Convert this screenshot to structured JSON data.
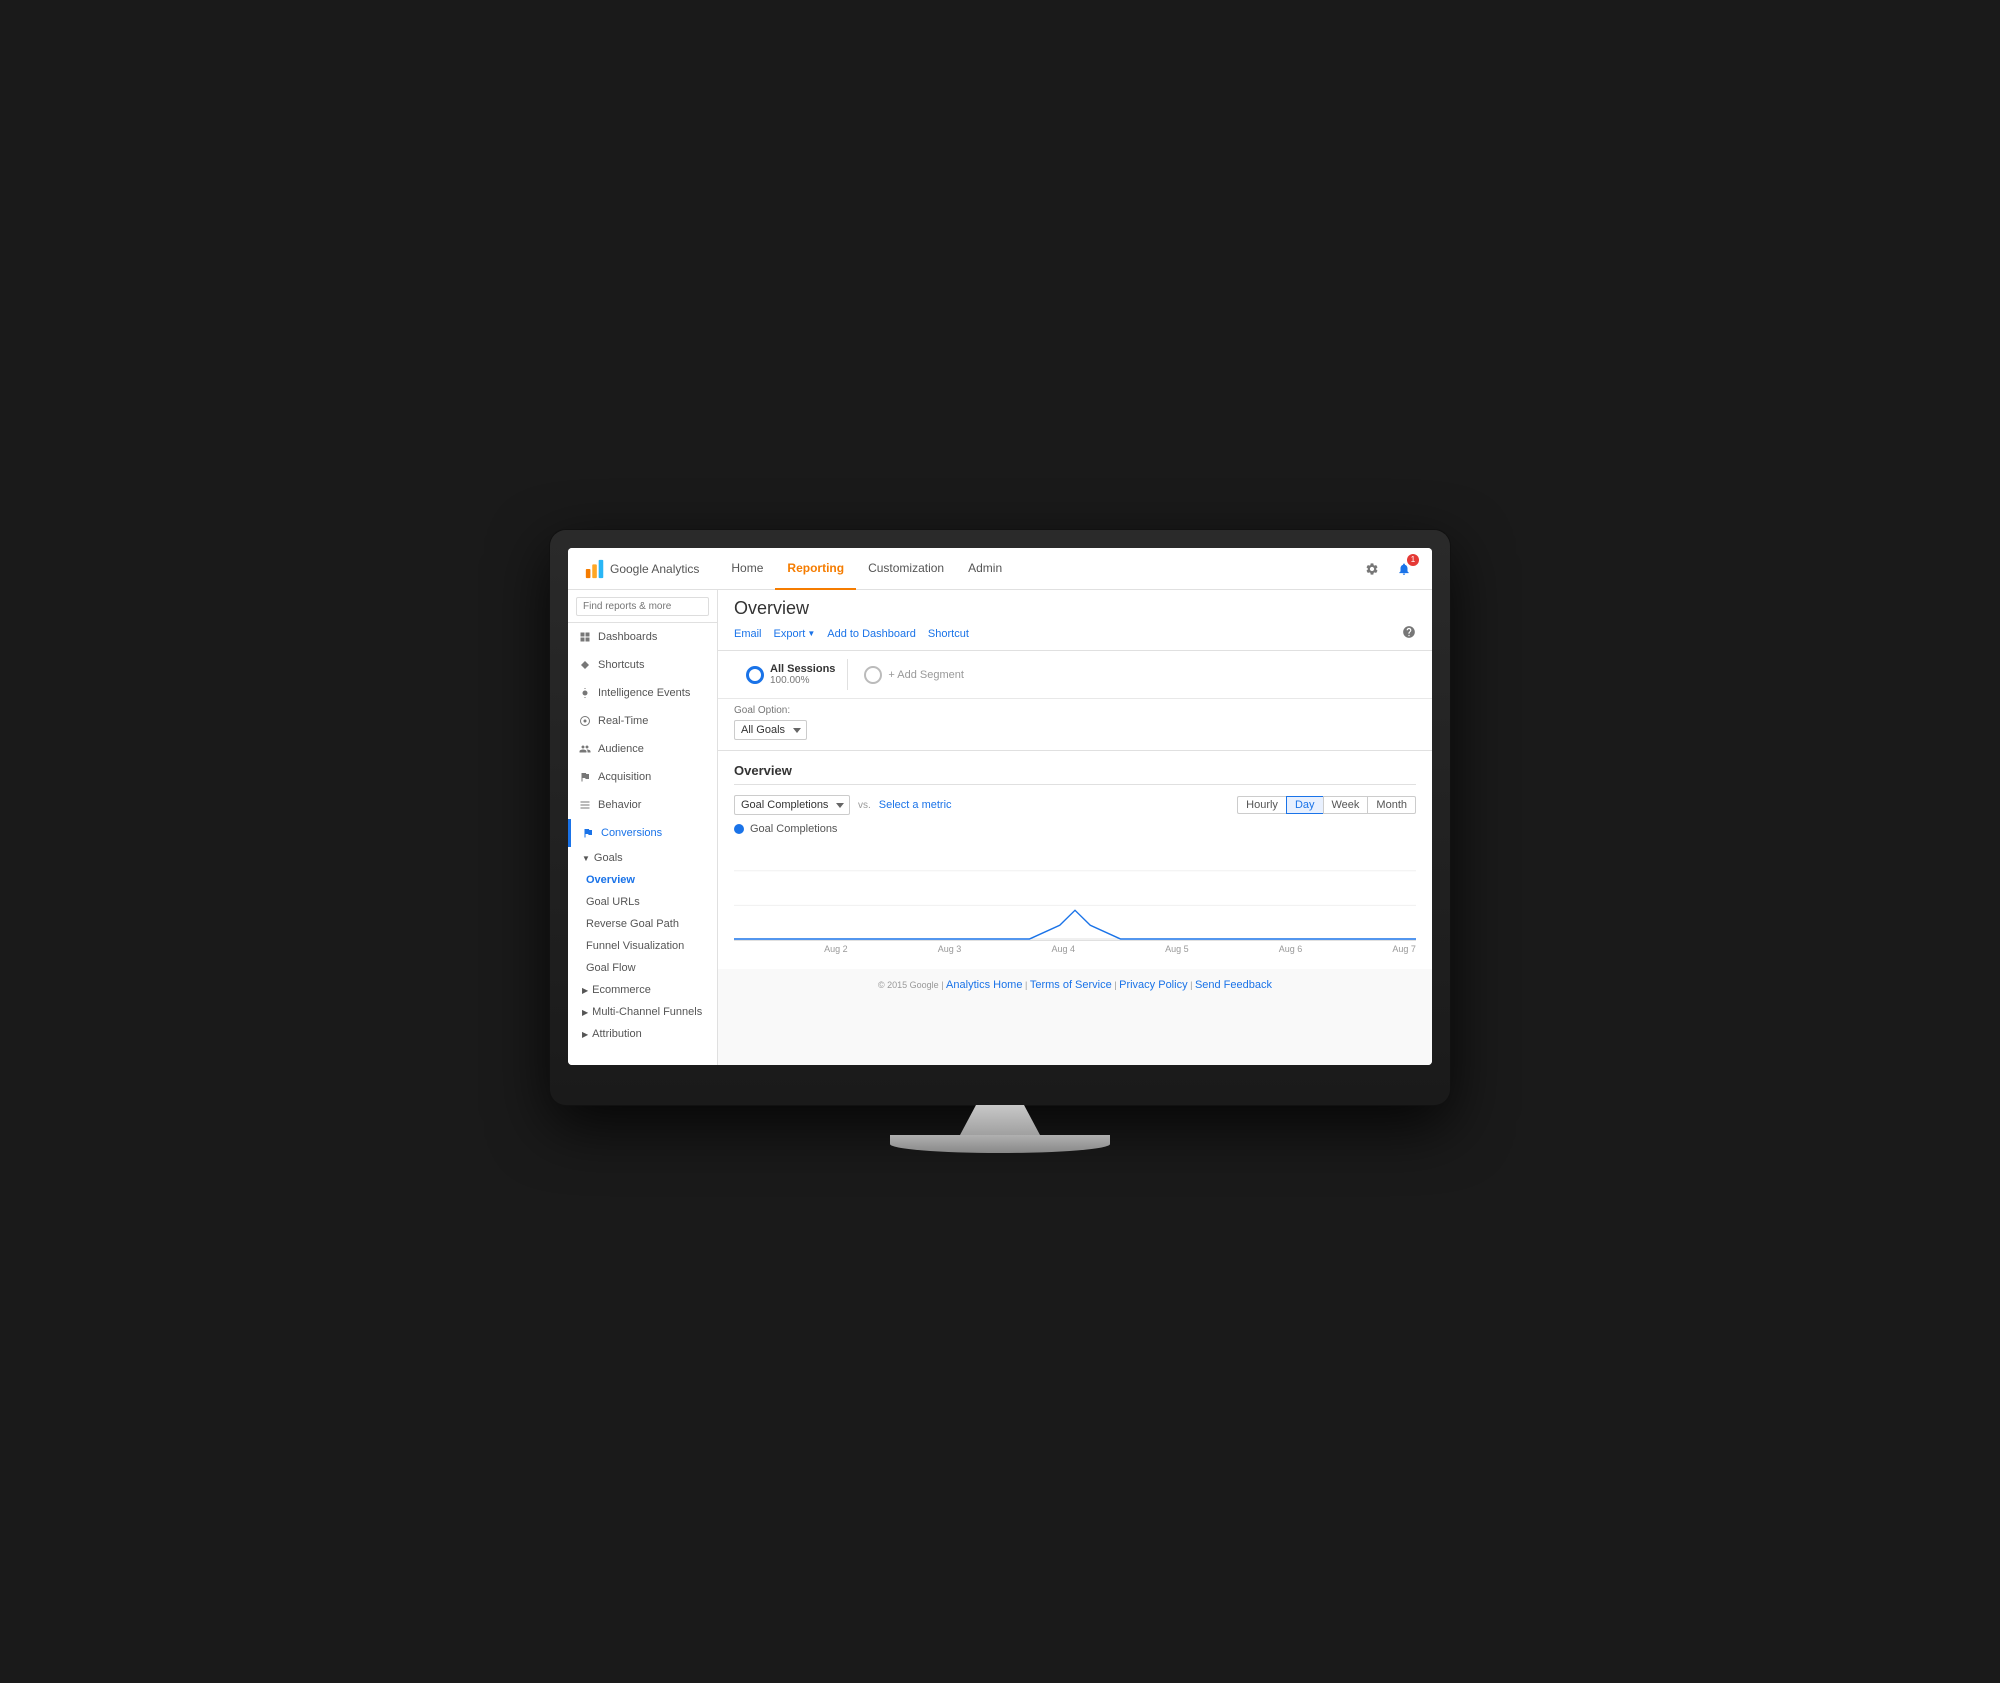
{
  "app": {
    "logo_text": "Google Analytics"
  },
  "topnav": {
    "links": [
      "Home",
      "Reporting",
      "Customization",
      "Admin"
    ],
    "active": "Reporting"
  },
  "sidebar": {
    "search_placeholder": "Find reports & more",
    "items": [
      {
        "id": "dashboards",
        "label": "Dashboards",
        "icon": "grid"
      },
      {
        "id": "shortcuts",
        "label": "Shortcuts",
        "icon": "arrow"
      },
      {
        "id": "intelligence",
        "label": "Intelligence Events",
        "icon": "bulb"
      },
      {
        "id": "realtime",
        "label": "Real-Time",
        "icon": "circle"
      },
      {
        "id": "audience",
        "label": "Audience",
        "icon": "people"
      },
      {
        "id": "acquisition",
        "label": "Acquisition",
        "icon": "flag"
      },
      {
        "id": "behavior",
        "label": "Behavior",
        "icon": "bars"
      },
      {
        "id": "conversions",
        "label": "Conversions",
        "icon": "flag",
        "active": true
      }
    ],
    "conversions_children": {
      "goals": {
        "label": "Goals",
        "children": [
          {
            "id": "overview",
            "label": "Overview",
            "active": true
          },
          {
            "id": "goal-urls",
            "label": "Goal URLs"
          },
          {
            "id": "reverse-goal-path",
            "label": "Reverse Goal Path"
          },
          {
            "id": "funnel-visualization",
            "label": "Funnel Visualization"
          },
          {
            "id": "goal-flow",
            "label": "Goal Flow"
          }
        ]
      },
      "ecommerce": {
        "label": "Ecommerce"
      },
      "multi-channel": {
        "label": "Multi-Channel Funnels"
      },
      "attribution": {
        "label": "Attribution"
      }
    }
  },
  "content": {
    "page_title": "Overview",
    "actions": {
      "email": "Email",
      "export": "Export",
      "add_to_dashboard": "Add to Dashboard",
      "shortcut": "Shortcut"
    },
    "segment": {
      "name": "All Sessions",
      "percent": "100.00%",
      "add_label": "+ Add Segment"
    },
    "goal_option": {
      "label": "Goal Option:",
      "value": "All Goals"
    },
    "overview_section": {
      "title": "Overview",
      "metric": "Goal Completions",
      "vs_text": "vs.",
      "select_metric": "Select a metric",
      "legend": "Goal Completions",
      "time_buttons": [
        "Hourly",
        "Day",
        "Week",
        "Month"
      ],
      "active_time": "Day",
      "xaxis_labels": [
        "",
        "Aug 2",
        "Aug 3",
        "Aug 4",
        "Aug 5",
        "Aug 6",
        "Aug 7"
      ]
    }
  },
  "footer": {
    "copyright": "© 2015 Google",
    "links": [
      "Analytics Home",
      "Terms of Service",
      "Privacy Policy",
      "Send Feedback"
    ]
  }
}
